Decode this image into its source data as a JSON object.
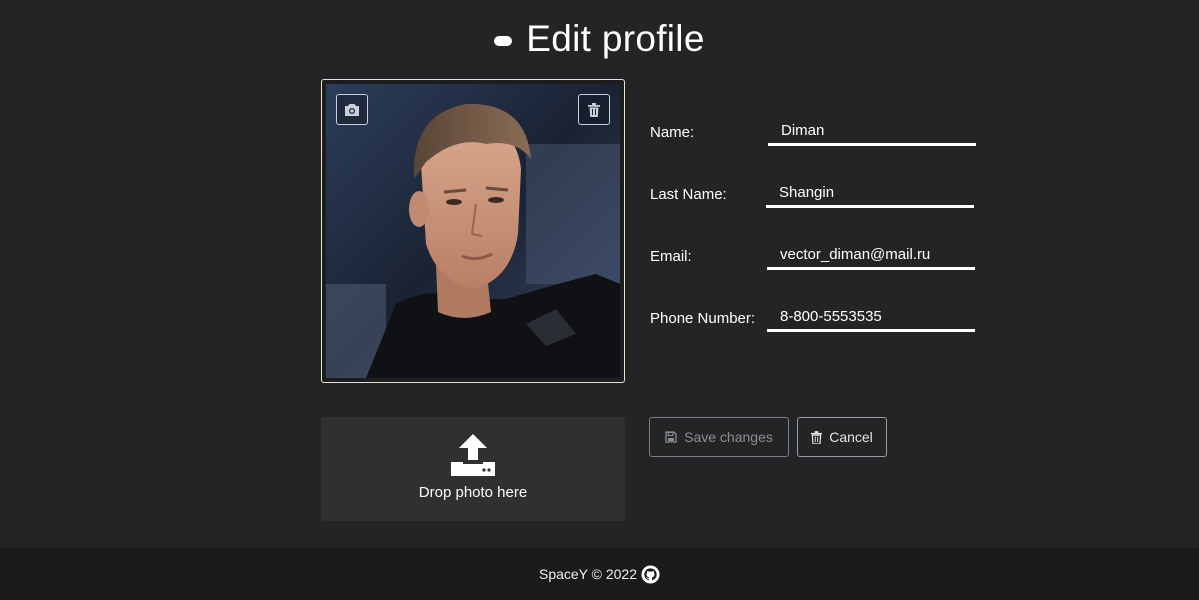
{
  "header": {
    "title": "Edit profile",
    "icon": "dot-icon"
  },
  "photo": {
    "alt": "profile photo",
    "camera_icon": "camera-icon",
    "delete_icon": "trash-icon"
  },
  "form": {
    "fields": [
      {
        "label": "Name:",
        "value": "Diman"
      },
      {
        "label": "Last Name:",
        "value": "Shangin"
      },
      {
        "label": "Email:",
        "value": "vector_diman@mail.ru"
      },
      {
        "label": "Phone Number:",
        "value": "8-800-5553535"
      }
    ]
  },
  "dropzone": {
    "icon": "upload-icon",
    "label": "Drop photo here"
  },
  "actions": {
    "save_label": "Save changes",
    "save_icon": "floppy-disk-icon",
    "cancel_label": "Cancel",
    "cancel_icon": "trash-icon"
  },
  "footer": {
    "text": "SpaceY © 2022",
    "github_icon": "github-icon"
  },
  "colors": {
    "background": "#232425",
    "footer": "#1b1b1c",
    "dropzone": "#2f3031",
    "text": "#ffffff",
    "photo_border": "#e8e2c8"
  }
}
